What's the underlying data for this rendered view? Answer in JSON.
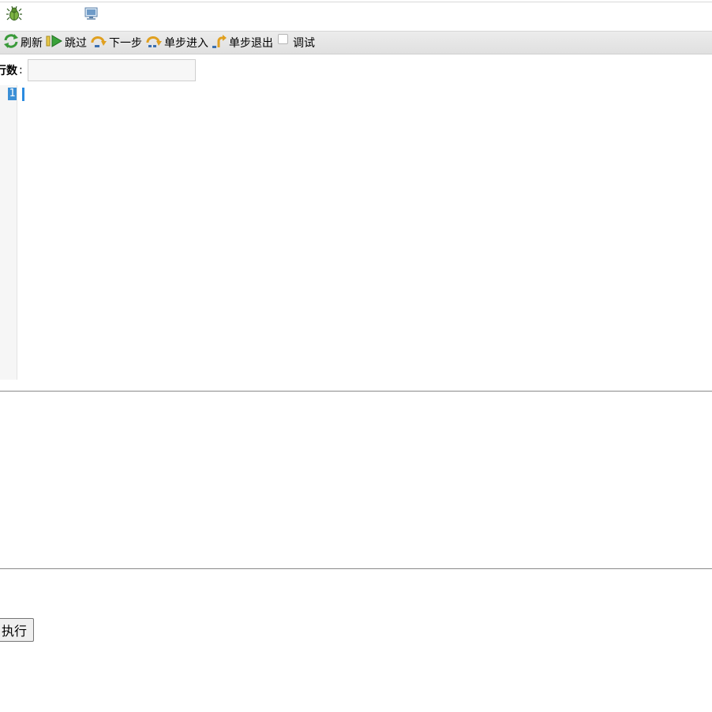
{
  "header": {
    "icons": [
      "bug-icon",
      "monitor-icon"
    ]
  },
  "toolbar": {
    "refresh_label": "刷新",
    "skip_label": "跳过",
    "next_label": "下一步",
    "step_into_label": "单步进入",
    "step_out_label": "单步退出",
    "debug_label": "调试",
    "debug_checked": false
  },
  "line_field": {
    "label": "行数",
    "colon": ":",
    "value": ""
  },
  "editor": {
    "line_numbers": [
      "1"
    ],
    "code": ""
  },
  "output": {
    "text": ""
  },
  "actions": {
    "run_label": "执行"
  },
  "colors": {
    "accent": "#3b8fd6",
    "toolbar_bg": "#e4e4e4",
    "divider": "#8a8a8a"
  }
}
